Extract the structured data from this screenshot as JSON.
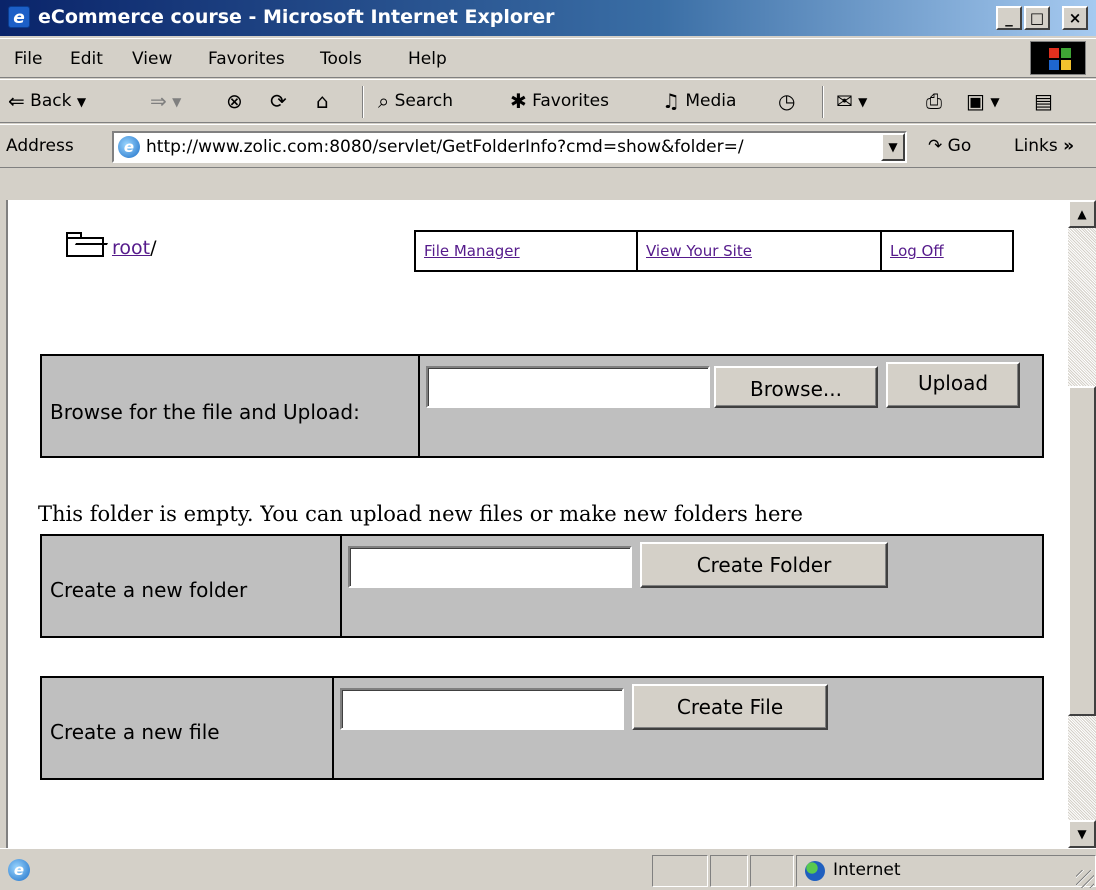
{
  "window": {
    "title": "eCommerce course - Microsoft Internet Explorer",
    "minimize": "_",
    "maximize": "□",
    "close": "×"
  },
  "menu": [
    "File",
    "Edit",
    "View",
    "Favorites",
    "Tools",
    "Help"
  ],
  "toolbar": {
    "back": "Back",
    "search": "Search",
    "favorites": "Favorites",
    "media": "Media"
  },
  "address": {
    "label": "Address",
    "url": "http://www.zolic.com:8080/servlet/GetFolderInfo?cmd=show&folder=/",
    "go": "Go",
    "links": "Links"
  },
  "page": {
    "folder_link": "root",
    "folder_sep": "/",
    "nav": [
      "File Manager",
      "View Your Site",
      "Log Off"
    ],
    "upload": {
      "label": "Browse for the file and Upload:",
      "file_value": "",
      "browse": "Browse...",
      "submit": "Upload"
    },
    "empty_message": "This folder is empty. You can upload new files or make new folders here",
    "new_folder": {
      "label": "Create a new folder",
      "value": "",
      "submit": "Create Folder"
    },
    "new_file": {
      "label": "Create a new file",
      "value": "",
      "submit": "Create File"
    }
  },
  "status": {
    "zone": "Internet"
  }
}
